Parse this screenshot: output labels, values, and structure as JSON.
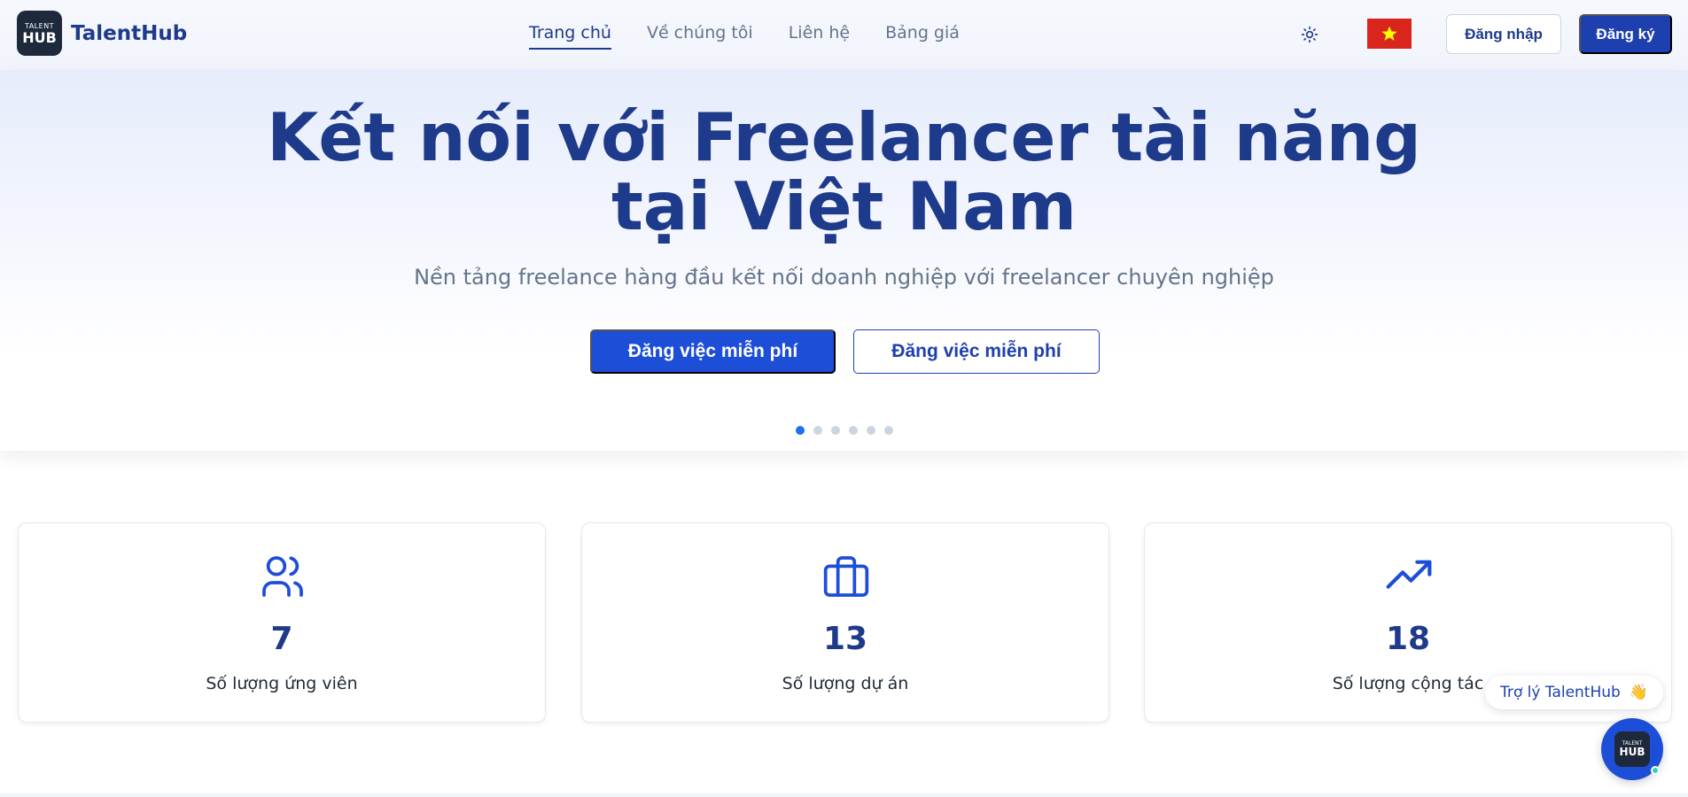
{
  "header": {
    "logo_line1": "TALENT",
    "logo_line2": "HUB",
    "brand": "TalentHub",
    "nav": [
      {
        "label": "Trang chủ",
        "active": true
      },
      {
        "label": "Về chúng tôi",
        "active": false
      },
      {
        "label": "Liên hệ",
        "active": false
      },
      {
        "label": "Bảng giá",
        "active": false
      }
    ],
    "theme_icon": "sun-icon",
    "language_flag": "vietnam-flag",
    "login_label": "Đăng nhập",
    "signup_label": "Đăng ký"
  },
  "hero": {
    "title_line1": "Kết nối với Freelancer tài năng",
    "title_line2": "tại Việt Nam",
    "subtitle": "Nền tảng freelance hàng đầu kết nối doanh nghiệp với freelancer chuyên nghiệp",
    "cta_primary": "Đăng việc miễn phí",
    "cta_secondary": "Đăng việc miễn phí",
    "slides_total": 6,
    "slide_active": 1
  },
  "stats": [
    {
      "icon": "users-icon",
      "value": "7",
      "label": "Số lượng ứng viên"
    },
    {
      "icon": "briefcase-icon",
      "value": "13",
      "label": "Số lượng dự án"
    },
    {
      "icon": "trending-up-icon",
      "value": "18",
      "label": "Số lượng cộng tác"
    }
  ],
  "chat": {
    "bubble_label": "Trợ lý TalentHub",
    "bubble_emoji": "👋",
    "fab_logo_line1": "TALENT",
    "fab_logo_line2": "HUB"
  },
  "colors": {
    "primary": "#1d4ed8",
    "brand_dark": "#1e3a8a",
    "muted": "#64748b",
    "flag_red": "#da251d",
    "flag_star": "#ffff00",
    "dot_active": "#1a73e8"
  }
}
